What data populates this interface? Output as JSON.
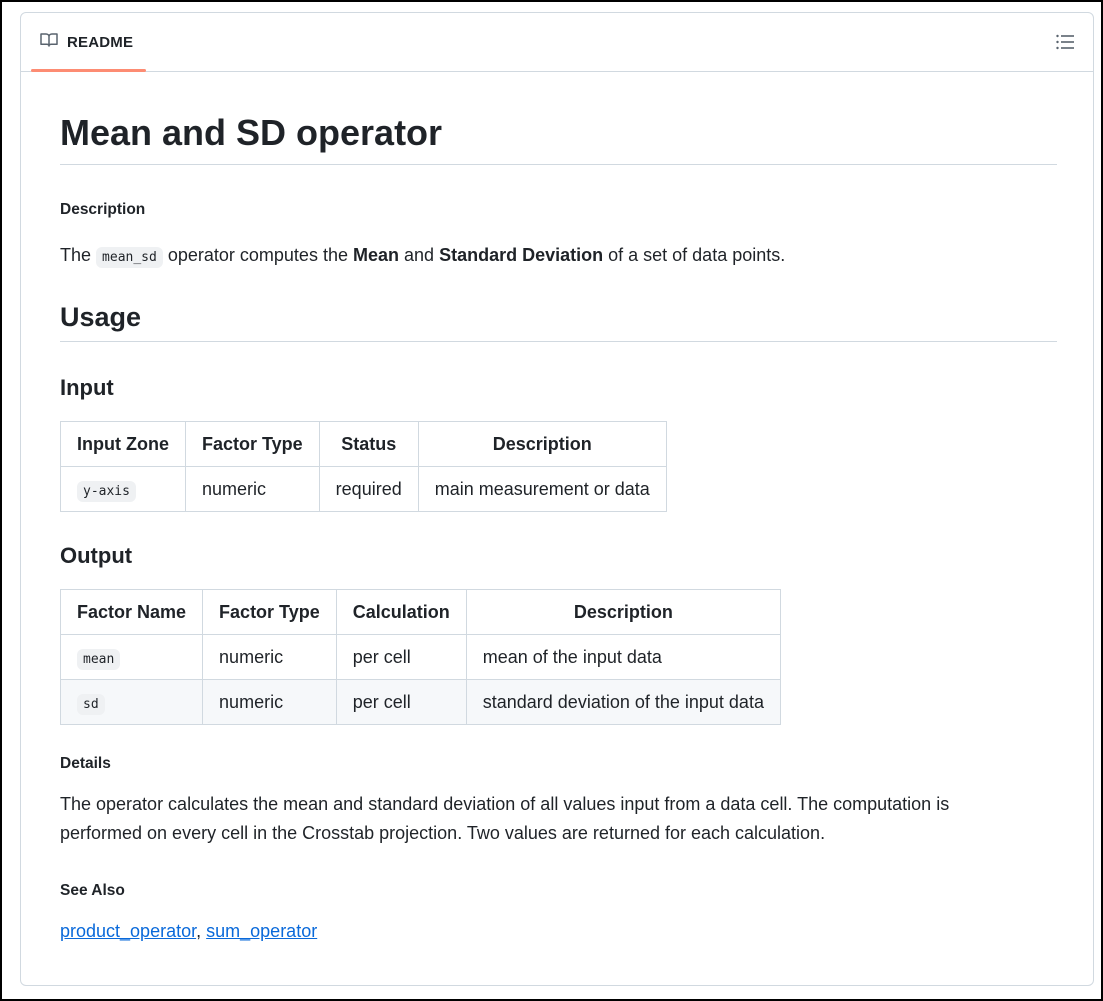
{
  "readme_tab": {
    "label": "README",
    "icon": "book-icon"
  },
  "toc_button": {
    "icon": "list-unordered-icon"
  },
  "title": "Mean and SD operator",
  "description_heading": "Description",
  "description": {
    "prefix": "The",
    "code": "mean_sd",
    "middle1": "operator computes the",
    "bold1": "Mean",
    "middle2": "and",
    "bold2": "Standard Deviation",
    "suffix": "of a set of data points."
  },
  "usage_heading": "Usage",
  "input_heading": "Input",
  "input_table": {
    "headers": [
      "Input Zone",
      "Factor Type",
      "Status",
      "Description"
    ],
    "rows": [
      [
        "y-axis",
        "numeric",
        "required",
        "main measurement or data"
      ]
    ]
  },
  "output_heading": "Output",
  "output_table": {
    "headers": [
      "Factor Name",
      "Factor Type",
      "Calculation",
      "Description"
    ],
    "rows": [
      [
        "mean",
        "numeric",
        "per cell",
        "mean of the input data"
      ],
      [
        "sd",
        "numeric",
        "per cell",
        "standard deviation of the input data"
      ]
    ]
  },
  "details_heading": "Details",
  "details_text": "The operator calculates the mean and standard deviation of all values input from a data cell. The computation is performed on every cell in the Crosstab projection. Two values are returned for each calculation.",
  "see_also_heading": "See Also",
  "see_also_links": [
    "product_operator",
    "sum_operator"
  ],
  "see_also_separator": ",",
  "colors": {
    "accent_underline": "#fd8c73",
    "link": "#0969da",
    "text": "#1f2328",
    "border": "#d1d9e0"
  }
}
